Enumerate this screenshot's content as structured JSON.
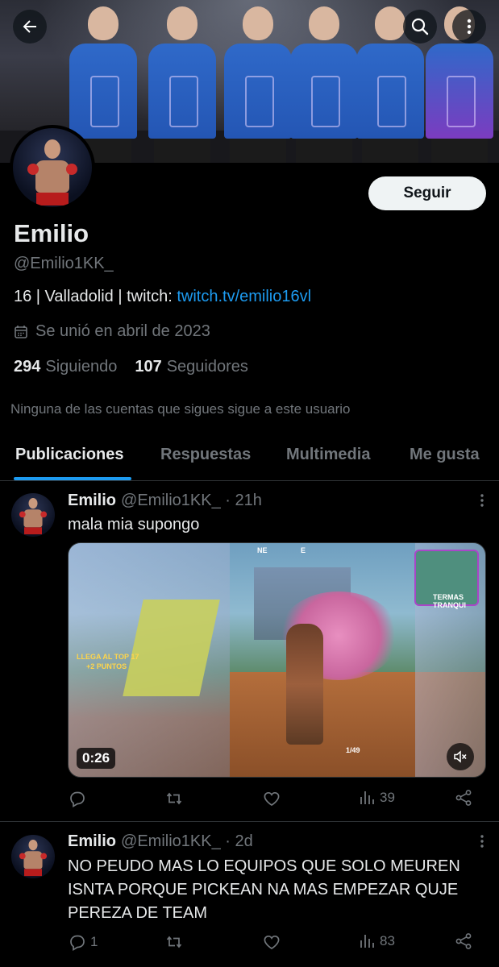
{
  "header": {
    "back_icon": "arrow-left-icon",
    "search_icon": "search-icon",
    "more_icon": "more-vertical-icon"
  },
  "profile": {
    "name": "Emilio",
    "handle": "@Emilio1KK_",
    "follow_label": "Seguir",
    "bio_text": "16 | Valladolid | twitch: ",
    "bio_link": "twitch.tv/emilio16vl",
    "joined": "Se unió en abril de 2023",
    "following_count": "294",
    "following_label": "Siguiendo",
    "followers_count": "107",
    "followers_label": "Seguidores",
    "notice": "Ninguna de las cuentas que sigues sigue a este usuario"
  },
  "tabs": [
    {
      "label": "Publicaciones",
      "active": true
    },
    {
      "label": "Respuestas",
      "active": false
    },
    {
      "label": "Multimedia",
      "active": false
    },
    {
      "label": "Me gusta",
      "active": false
    }
  ],
  "posts": [
    {
      "name": "Emilio",
      "meta": "@Emilio1KK_ · 21h",
      "text": "mala mia supongo",
      "media": {
        "duration": "0:26",
        "hud": [
          "LLEGA AL TOP 17",
          "+2 PUNTOS",
          "TERMAS TRANQUI",
          "1/49",
          "NE",
          "E",
          "0:26"
        ]
      },
      "replies": "",
      "views": "39"
    },
    {
      "name": "Emilio",
      "meta": "@Emilio1KK_ · 2d",
      "text": "NO PEUDO MAS LO EQUIPOS QUE SOLO MEUREN ISNTA PORQUE PICKEAN NA MAS EMPEZAR QUJE PEREZA DE TEAM",
      "replies": "1",
      "views": "83"
    }
  ],
  "colors": {
    "accent": "#1d9bf0",
    "background": "#000000",
    "text": "#e7e9ea",
    "muted": "#71767b",
    "divider": "#2f3336"
  }
}
